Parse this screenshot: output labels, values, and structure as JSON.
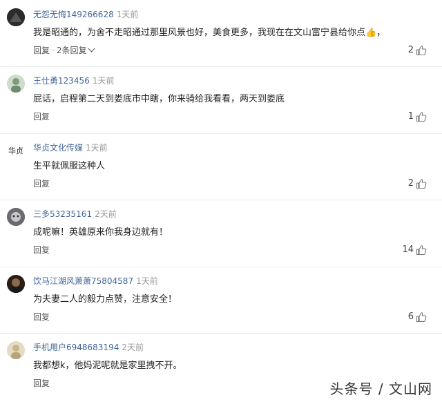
{
  "comments": [
    {
      "username": "无怨无悔149266628",
      "time": "1天前",
      "text": "我是昭通的，为舍不走昭通过那里风景也好，美食更多，我现在在文山富宁县给你点👍，",
      "reply_label": "回复",
      "sep": "·",
      "replies_label": "2条回复",
      "likes": "2",
      "avatar_color": "#333333"
    },
    {
      "username": "王仕勇123456",
      "time": "1天前",
      "text": "屁话，启程第二天到娄底市中瞎，你来骑给我看看，两天到娄底",
      "reply_label": "回复",
      "likes": "1",
      "avatar_color": "#8fa890"
    },
    {
      "username": "华贞文化传媒",
      "time": "1天前",
      "text": "生平就佩服这种人",
      "reply_label": "回复",
      "likes": "2",
      "avatar_text": "华贞",
      "avatar_color": "#ffffff"
    },
    {
      "username": "三多53235161",
      "time": "2天前",
      "text": "成呢嘛！英雄原来你我身边就有！",
      "reply_label": "回复",
      "likes": "14",
      "avatar_color": "#556"
    },
    {
      "username": "饮马江湖风萧萧75804587",
      "time": "1天前",
      "text": "为夫妻二人的毅力点赞，注意安全！",
      "reply_label": "回复",
      "likes": "6",
      "avatar_color": "#3a2a1a"
    },
    {
      "username": "手机用户6948683194",
      "time": "2天前",
      "text": "我都想k，他妈泥呢就是家里拽不开。",
      "reply_label": "回复",
      "likes": "",
      "avatar_color": "#d8c9a8"
    }
  ],
  "watermark": "头条号 / 文山网"
}
